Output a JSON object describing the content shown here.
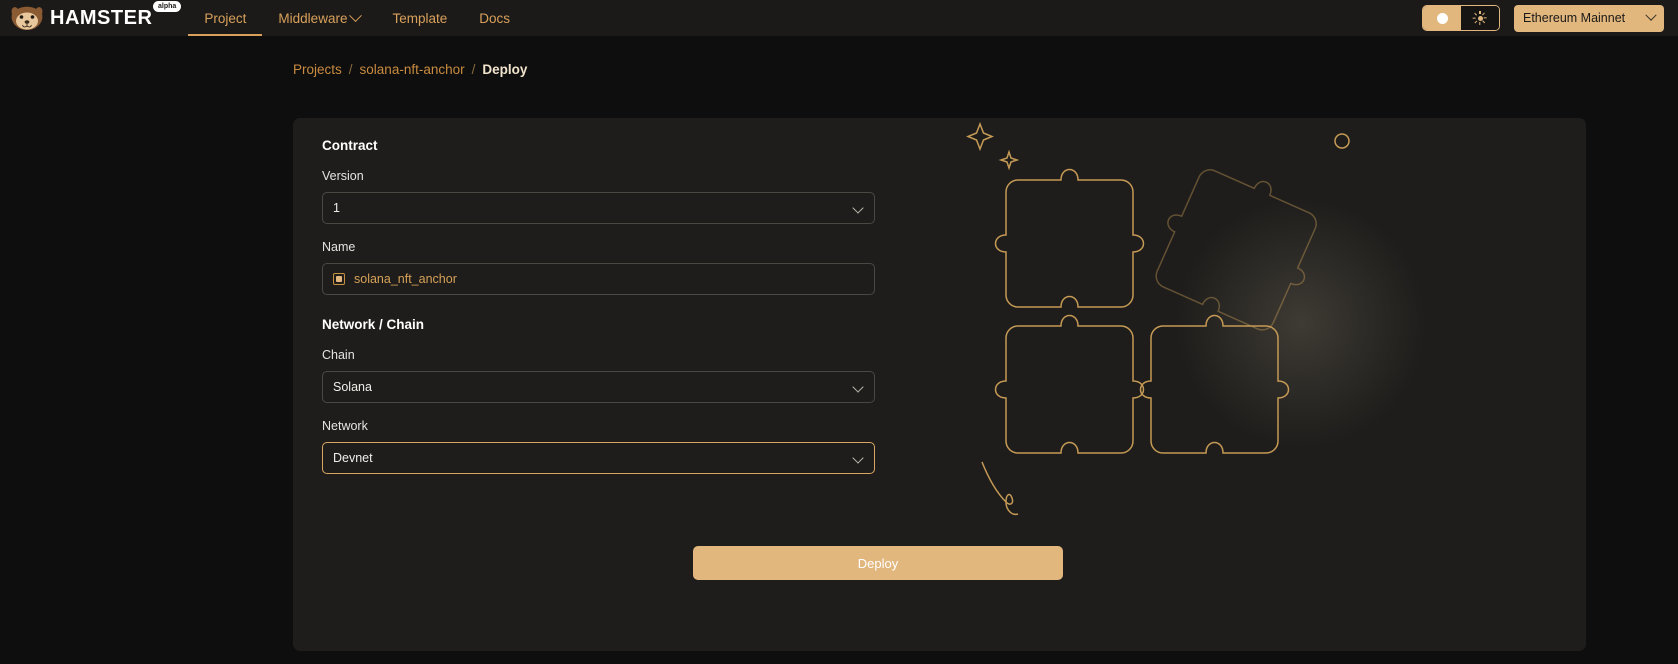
{
  "topbar": {
    "brand_name": "HAMSTER",
    "brand_badge": "alpha",
    "nav": [
      {
        "label": "Project",
        "icon": "",
        "active": true
      },
      {
        "label": "Middleware",
        "icon": "chevron-down-icon",
        "active": false
      },
      {
        "label": "Template",
        "icon": "",
        "active": false
      },
      {
        "label": "Docs",
        "icon": "",
        "active": false
      }
    ],
    "theme_toggle": {
      "dark_icon": "moon-icon",
      "light_icon": "sun-icon",
      "selected": "light"
    },
    "network_selector": {
      "value": "Ethereum Mainnet",
      "icon": "chevron-down-icon"
    }
  },
  "breadcrumb": {
    "root": "Projects",
    "separator": "/",
    "project": "solana-nft-anchor",
    "current": "Deploy"
  },
  "form": {
    "contract_section": "Contract",
    "version_label": "Version",
    "version_value": "1",
    "name_label": "Name",
    "name_value": "solana_nft_anchor",
    "network_section": "Network / Chain",
    "chain_label": "Chain",
    "chain_value": "Solana",
    "network_label": "Network",
    "network_value": "Devnet",
    "deploy_label": "Deploy"
  },
  "colors": {
    "accent": "#e2b77e",
    "accent_text": "#d9a05b",
    "panel": "#1e1d1b",
    "page_bg": "#0e0e0e",
    "topbar_bg": "#1b1a18",
    "border": "#4a4843",
    "focus_border": "#d9a661"
  },
  "illustration": {
    "name": "puzzle-pieces-illustration",
    "stroke": "#c59a55"
  }
}
